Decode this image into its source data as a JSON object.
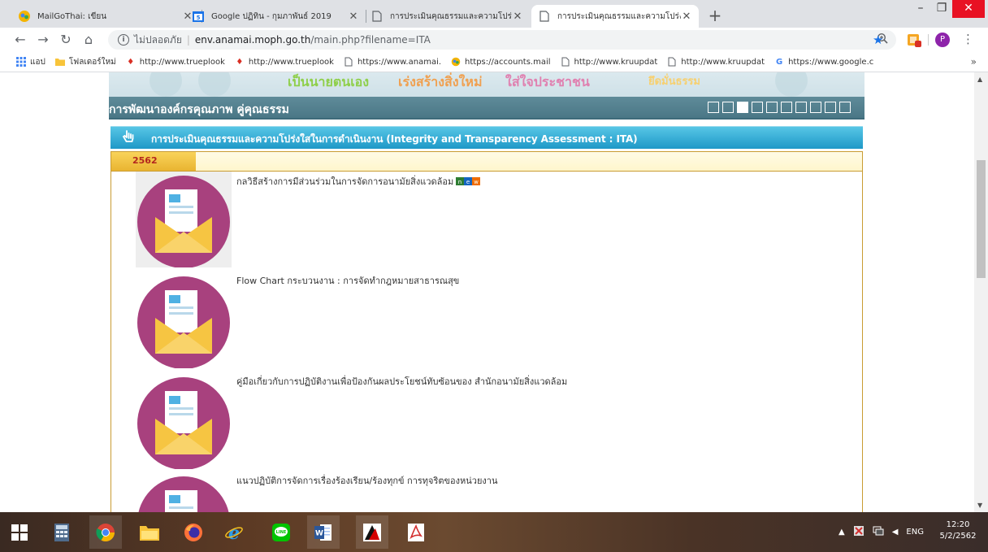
{
  "browser": {
    "tabs": [
      {
        "title": "MailGoThai: เขียน",
        "favicon": "mailgothai-icon",
        "active": false
      },
      {
        "title": "Google ปฏิทิน - กุมภาพันธ์ 2019",
        "favicon": "google-calendar-icon",
        "active": false
      },
      {
        "title": "การประเมินคุณธรรมและความโปร่งใสในก",
        "favicon": "page-icon",
        "active": false
      },
      {
        "title": "การประเมินคุณธรรมและความโปร่งใสในก",
        "favicon": "page-icon",
        "active": true
      }
    ],
    "new_tab_label": "+",
    "omnibox": {
      "security_text": "ไม่ปลอดภัย",
      "host": "env.anamai.moph.go.th",
      "path": "/main.php?filename=ITA"
    },
    "profile_initial": "P",
    "bookmarks": [
      {
        "label": "แอป",
        "icon": "apps-icon"
      },
      {
        "label": "โฟลเดอร์ใหม่",
        "icon": "folder-icon"
      },
      {
        "label": "http://www.trueplook",
        "icon": "trueplookpanya-icon"
      },
      {
        "label": "http://www.trueplook",
        "icon": "trueplookpanya-icon"
      },
      {
        "label": "https://www.anamai.",
        "icon": "page-icon"
      },
      {
        "label": "https://accounts.mail",
        "icon": "mailgothai-icon"
      },
      {
        "label": "http://www.kruupdat",
        "icon": "page-icon"
      },
      {
        "label": "http://www.kruupdat",
        "icon": "page-icon"
      },
      {
        "label": "https://www.google.c",
        "icon": "google-icon"
      }
    ],
    "bookmarks_more": "»"
  },
  "page": {
    "banner_mottos": [
      "เป็นนายตนเอง",
      "เร่งสร้างสิ่งใหม่",
      "ใส่ใจประชาชน",
      "ยึดมั่นธรรม"
    ],
    "section_title": "การพัฒนาองค์กรคุณภาพ คู่คุณธรรม",
    "pager_count": 10,
    "pager_active_index": 2,
    "ita_heading": "การประเมินคุณธรรมและความโปร่งใสในการดำเนินงาน (Integrity and Transparency Assessment : ITA)",
    "year": "2562",
    "documents": [
      {
        "title": "กลวิธีสร้างการมีส่วนร่วมในการจัดการอนามัยสิ่งแวดล้อม",
        "new": true,
        "new_badge": "new"
      },
      {
        "title": "Flow Chart กระบวนงาน : การจัดทำกฎหมายสาธารณสุข",
        "new": false
      },
      {
        "title": "คู่มือเกี่ยวกับการปฏิบัติงานเพื่อป้องกันผลประโยชน์ทับซ้อนของ สำนักอนามัยสิ่งแวดล้อม",
        "new": false
      },
      {
        "title": "แนวปฏิบัติการจัดการเรื่องร้องเรียน/ร้องทุกข์ การทุจริตของหน่วยงาน",
        "new": false
      }
    ]
  },
  "taskbar": {
    "apps": [
      "windows-start-icon",
      "calculator-icon",
      "chrome-icon",
      "file-explorer-icon",
      "firefox-icon",
      "internet-explorer-icon",
      "line-icon",
      "word-icon",
      "kingsoft-icon",
      "acrobat-icon"
    ],
    "tray_lang": "ENG",
    "time": "12:20",
    "date": "5/2/2562"
  },
  "colors": {
    "section_head": "#4a7786",
    "subhead": "#1e98c7",
    "year_tab": "#e9b431",
    "year_text": "#b3261e",
    "envelope_circle": "#a8417e",
    "envelope_body": "#f6c542"
  }
}
